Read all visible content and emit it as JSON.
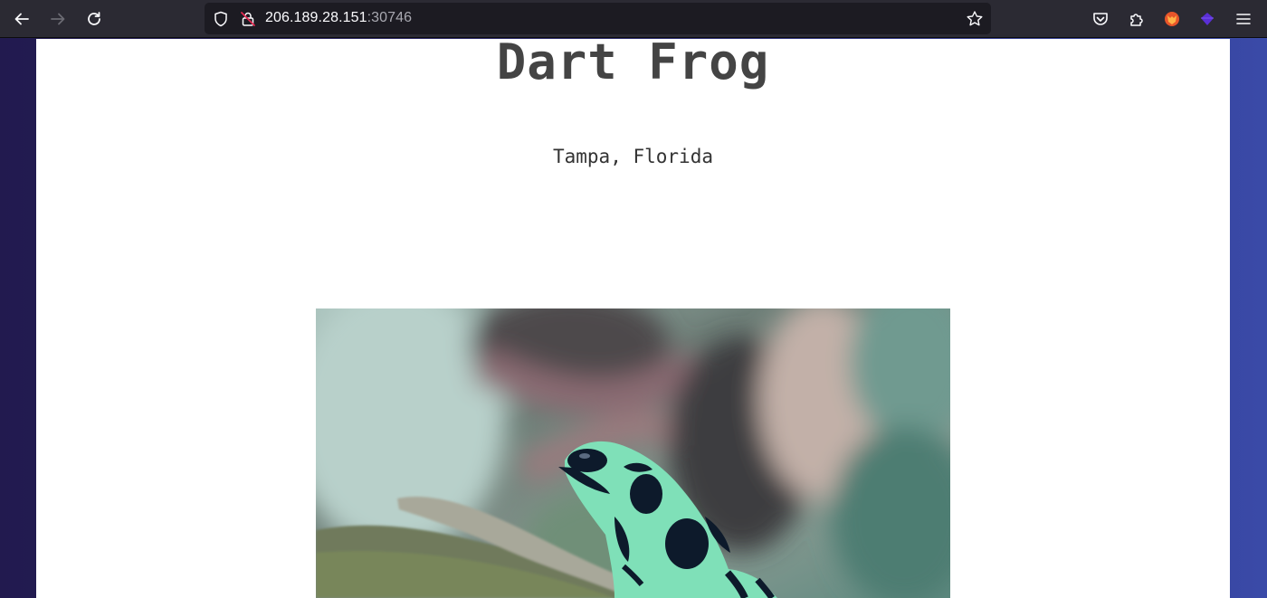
{
  "browser": {
    "url_host": "206.189.28.151",
    "url_port": ":30746",
    "icons": {
      "back": "arrow-left-icon",
      "forward": "arrow-right-icon",
      "reload": "reload-icon",
      "shield": "tracking-protection-shield-icon",
      "lock": "insecure-lock-icon",
      "bookmark": "star-icon",
      "pocket": "pocket-icon",
      "extensions": "puzzle-piece-icon",
      "menu": "hamburger-menu-icon"
    }
  },
  "page": {
    "title": "Dart Frog",
    "location": "Tampa, Florida",
    "image_description_icon": "frog-photo"
  },
  "colors": {
    "toolbar": "#2b2a33",
    "urlbar": "#1c1b22",
    "page_bg": "#ffffff",
    "title_text": "#444444",
    "frog_green": "#7fe0b8",
    "frog_black": "#0d1a2b"
  }
}
